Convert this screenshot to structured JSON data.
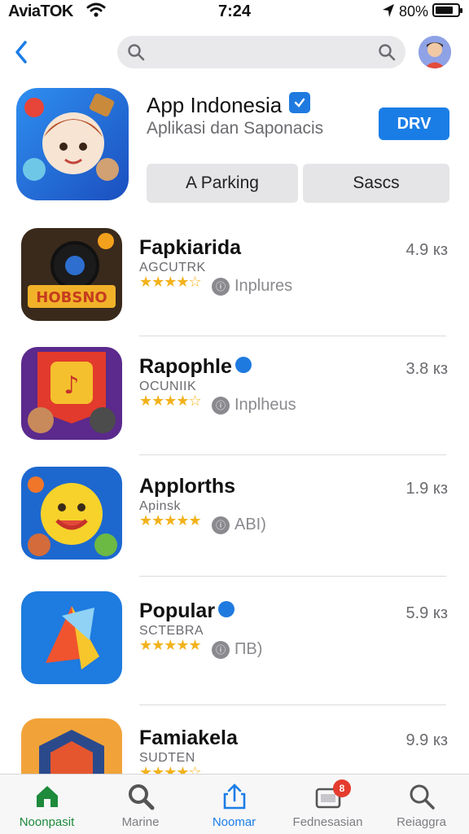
{
  "status_bar": {
    "carrier": "AviaTOK",
    "time": "7:24",
    "battery_percent": "80%",
    "battery_level": 0.8,
    "icons": [
      "wifi-icon",
      "location-arrow-icon",
      "battery-icon"
    ]
  },
  "nav": {
    "back_icon": "chevron-left-icon",
    "search_placeholder": "",
    "search_icons": [
      "search-icon",
      "search-icon"
    ],
    "avatar": "user-avatar"
  },
  "hero": {
    "title": "App Indonesia",
    "subtitle": "Aplikasi dan Saponacis",
    "get_label": "DRV",
    "segments": [
      "A Parking",
      "Sascs"
    ],
    "verified_icon": "verified-check-icon"
  },
  "apps": [
    {
      "name": "Fapkiarida",
      "category": "AGCUTRK",
      "stars": 4.5,
      "info_icon": "info-circle-icon",
      "info": "Inplures",
      "size": "4.9 кз"
    },
    {
      "name": "Rapophle",
      "category": "OCUNIIK",
      "stars": 4.5,
      "info_icon": "info-circle-icon",
      "info": "Inplheus",
      "size": "3.8 кз"
    },
    {
      "name": "Applorths",
      "category": "Apinsk",
      "stars": 5,
      "info_icon": "info-circle-icon",
      "info": "ABI)",
      "size": "1.9 кз"
    },
    {
      "name": "Popular",
      "category": "SCTEBRA",
      "stars": 5,
      "info_icon": "info-circle-icon",
      "info": "ПВ)",
      "size": "5.9 кз"
    },
    {
      "name": "Famiakela",
      "category": "SUDTEN",
      "stars": 4.5,
      "info_icon": "info-circle-icon",
      "info": "",
      "size": "9.9 кз"
    }
  ],
  "tabs": [
    {
      "label": "Noonpasit",
      "icon": "home-icon"
    },
    {
      "label": "Marine",
      "icon": "search-icon"
    },
    {
      "label": "Noomar",
      "icon": "share-icon"
    },
    {
      "label": "Fednesasian",
      "icon": "updates-icon",
      "badge": "8"
    },
    {
      "label": "Reiaggra",
      "icon": "search-icon"
    }
  ],
  "colors": {
    "accent": "#1a7de6",
    "star": "#f2b21b",
    "active_tab_green": "#1e8a3c",
    "badge_red": "#e43c2e"
  }
}
